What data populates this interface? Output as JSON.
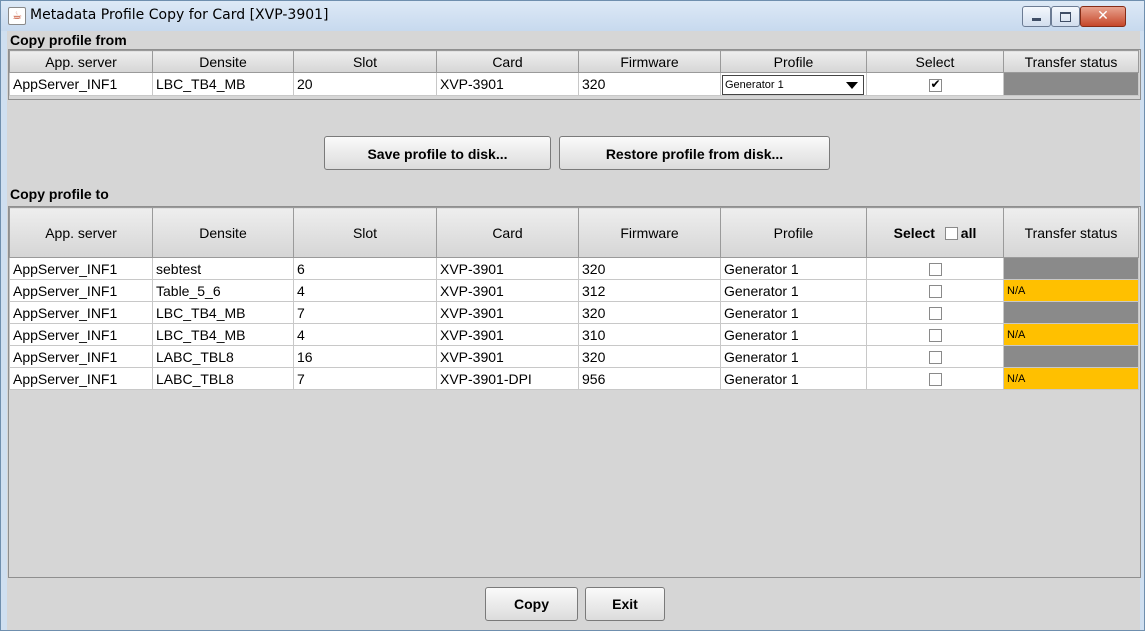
{
  "window": {
    "title": "Metadata Profile Copy for Card [XVP-3901]",
    "icon": "java-icon",
    "controls": {
      "minimize": "minimize",
      "maximize": "maximize",
      "close": "✕"
    }
  },
  "copy_from": {
    "label": "Copy profile from",
    "columns": [
      "App. server",
      "Densite",
      "Slot",
      "Card",
      "Firmware",
      "Profile",
      "Select",
      "Transfer status"
    ],
    "row": {
      "app_server": "AppServer_INF1",
      "densite": "LBC_TB4_MB",
      "slot": "20",
      "card": "XVP-3901",
      "firmware": "320",
      "profile": "Generator 1",
      "selected": true,
      "transfer_status": ""
    }
  },
  "disk_buttons": {
    "save": "Save profile to disk...",
    "restore": "Restore profile from disk..."
  },
  "copy_to": {
    "label": "Copy profile to",
    "columns": [
      "App. server",
      "Densite",
      "Slot",
      "Card",
      "Firmware",
      "Profile",
      "Select",
      "all",
      "Transfer status"
    ],
    "rows": [
      {
        "app_server": "AppServer_INF1",
        "densite": "sebtest",
        "slot": "6",
        "card": "XVP-3901",
        "firmware": "320",
        "profile": "Generator 1",
        "selected": false,
        "transfer_status": ""
      },
      {
        "app_server": "AppServer_INF1",
        "densite": "Table_5_6",
        "slot": "4",
        "card": "XVP-3901",
        "firmware": "312",
        "profile": "Generator 1",
        "selected": false,
        "transfer_status": "N/A"
      },
      {
        "app_server": "AppServer_INF1",
        "densite": "LBC_TB4_MB",
        "slot": "7",
        "card": "XVP-3901",
        "firmware": "320",
        "profile": "Generator 1",
        "selected": false,
        "transfer_status": ""
      },
      {
        "app_server": "AppServer_INF1",
        "densite": "LBC_TB4_MB",
        "slot": "4",
        "card": "XVP-3901",
        "firmware": "310",
        "profile": "Generator 1",
        "selected": false,
        "transfer_status": "N/A"
      },
      {
        "app_server": "AppServer_INF1",
        "densite": "LABC_TBL8",
        "slot": "16",
        "card": "XVP-3901",
        "firmware": "320",
        "profile": "Generator 1",
        "selected": false,
        "transfer_status": ""
      },
      {
        "app_server": "AppServer_INF1",
        "densite": "LABC_TBL8",
        "slot": "7",
        "card": "XVP-3901-DPI",
        "firmware": "956",
        "profile": "Generator 1",
        "selected": false,
        "transfer_status": "N/A"
      }
    ]
  },
  "footer": {
    "copy": "Copy",
    "exit": "Exit"
  },
  "colors": {
    "status_blank": "#8a8a8a",
    "status_na": "#ffc000"
  }
}
